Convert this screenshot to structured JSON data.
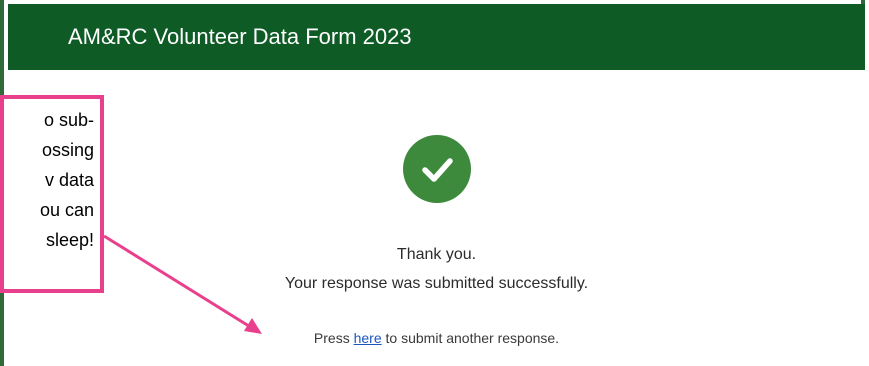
{
  "header": {
    "title": "AM&RC Volunteer Data Form 2023"
  },
  "confirmation": {
    "icon": "checkmark-icon",
    "line1": "Thank you.",
    "line2": "Your response was submitted successfully.",
    "press_prefix": "Press",
    "link_label": "here",
    "press_suffix": "to submit another response."
  },
  "callout": {
    "lines": [
      "o sub-",
      "ossing",
      "v data",
      "ou can",
      "sleep!"
    ]
  },
  "colors": {
    "header_bg": "#0e5b26",
    "check_bg": "#3e8a3c",
    "callout_border": "#e9408e",
    "link": "#1b56c0"
  }
}
